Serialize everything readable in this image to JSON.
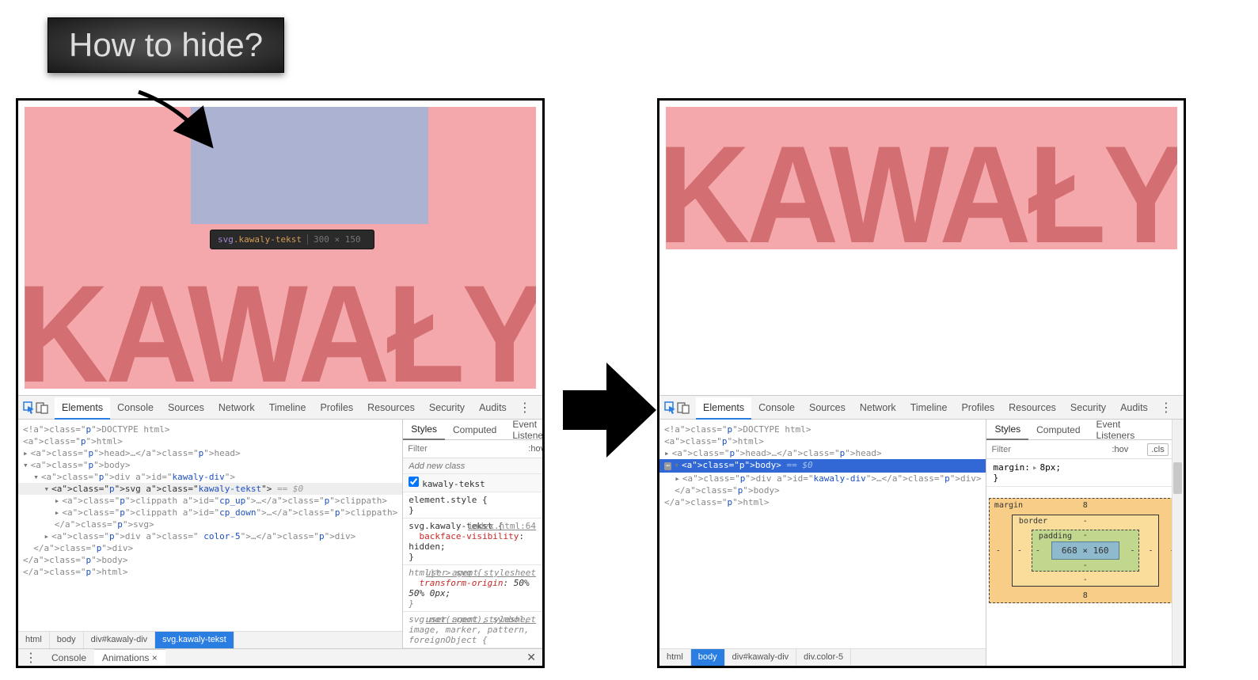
{
  "callout": {
    "text": "How to hide?"
  },
  "viewport": {
    "banner_text": "KAWAŁY",
    "tooltip": {
      "tag": "svg",
      "class": ".kawaly-tekst",
      "dims": "300 × 150"
    }
  },
  "devtools": {
    "tabs": [
      "Elements",
      "Console",
      "Sources",
      "Network",
      "Timeline",
      "Profiles",
      "Resources",
      "Security",
      "Audits"
    ],
    "active_tab": "Elements",
    "dom_left": {
      "lines": [
        "<!DOCTYPE html>",
        "<html>",
        "▸<head>…</head>",
        "▾<body>",
        "  ▾<div id=\"kawaly-div\">",
        "    ▾<svg class=\"kawaly-tekst\"> == $0",
        "      ▸<clippath id=\"cp_up\">…</clippath>",
        "      ▸<clippath id=\"cp_down\">…</clippath>",
        "      </svg>",
        "    ▸<div class=\" color-5\">…</div>",
        "  </div>",
        "</body>",
        "</html>"
      ],
      "crumbs": [
        "html",
        "body",
        "div#kawaly-div",
        "svg.kawaly-tekst"
      ],
      "active_crumb": "svg.kawaly-tekst"
    },
    "dom_right": {
      "lines": [
        "<!DOCTYPE html>",
        "<html>",
        "▸<head>…</head>",
        "⋯▾<body> == $0",
        "  ▸<div id=\"kawaly-div\">…</div>",
        "  </body>",
        "</html>"
      ],
      "crumbs": [
        "html",
        "body",
        "div#kawaly-div",
        "div.color-5"
      ],
      "active_crumb": "body"
    },
    "styles": {
      "tabs": [
        "Styles",
        "Computed",
        "Event Listeners"
      ],
      "active": "Styles",
      "filter_placeholder": "Filter",
      "hov": ":hov",
      "cls": ".cls",
      "add_class_placeholder": "Add new class",
      "class_checkbox_label": "kawaly-tekst",
      "rule_element_style": "element.style {",
      "rule_close": "}",
      "rule_svg_sel": "svg.kawaly-tekst {",
      "rule_svg_src": "index.html:64",
      "rule_svg_prop": "backface-visibility",
      "rule_svg_val": ": hidden;",
      "rule_ua1_sel": "html|* > svg {",
      "rule_ua1_note": "user agent stylesheet",
      "rule_ua1_prop": "transform-origin",
      "rule_ua1_val": ": 50% 50% 0px;",
      "rule_ua2_a": "svg:not(:root), symbol,",
      "rule_ua2_b": "image, marker, pattern, foreignObject {",
      "margin_prop": "margin",
      "margin_val": "8px;",
      "boxmodel": {
        "content": "668 × 160",
        "m_top": "8",
        "m_bottom": "8"
      }
    },
    "drawer": {
      "tabs": [
        "Console",
        "Animations ×"
      ]
    }
  }
}
